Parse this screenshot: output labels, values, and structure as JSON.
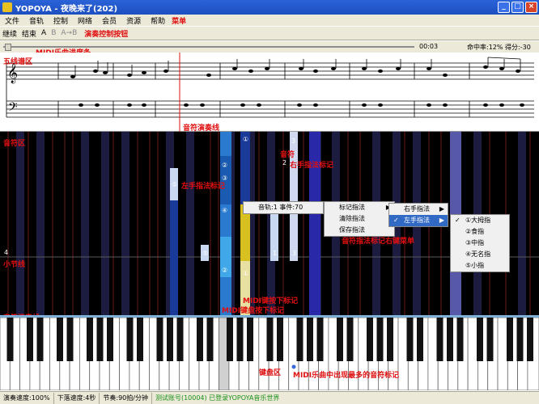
{
  "window": {
    "title": "YOPOYA - 夜晚来了(202)",
    "close": "×",
    "minimize": "_",
    "maximize": "□"
  },
  "menubar": {
    "items": [
      "文件",
      "音轨",
      "控制",
      "网络",
      "会员",
      "资源",
      "帮助"
    ],
    "note": "菜单"
  },
  "toolbar": {
    "loop": "继续",
    "stop": "结束",
    "a": "A",
    "b": "B",
    "ab": "A→B",
    "note": "演奏控制按钮"
  },
  "progress": {
    "label": "MIDI乐曲进度条",
    "time": "00:03",
    "score": "命中率:12%  得分:-30",
    "value": 0.01
  },
  "annotations": {
    "staff_area": "五线谱区",
    "playhead": "音符演奏线",
    "note_area": "音符区",
    "note": "音符",
    "right_hand": "右手指法标记",
    "left_hand": "左手指法标记",
    "measure_line": "小节线",
    "performance_line": "音符演奏线",
    "midi_keydown": "MIDI键按下标记",
    "midi_keyhit": "MIDI键盘按下标记",
    "finger_menu": "音符指法标记右键菜单",
    "keyboard_area": "键盘区",
    "most_note": "MIDI乐曲中出现最多的音符标记"
  },
  "context_menu": {
    "track": "音轨:1  事件:70",
    "level1": [
      "标记指法",
      "清除指法",
      "保存指法"
    ],
    "level2": [
      "右手指法",
      "左手指法"
    ],
    "level3": [
      "①大拇指",
      "②食指",
      "③中指",
      "④无名指",
      "⑤小指"
    ]
  },
  "piano_labels": {
    "n1": "3",
    "n2": "2",
    "n3": "1",
    "n4": "3",
    "measure": "4",
    "circ1": "①",
    "circ5": "⑤",
    "circ4": "④",
    "circ2": "②",
    "circ3": "③"
  },
  "statusbar": {
    "play_speed": "演奏速度:100%",
    "fall_speed": "下落速度:4秒",
    "tempo": "节奏:90拍/分钟",
    "user": "测试账号(10004) 已登录YOPOYA音乐世界"
  }
}
